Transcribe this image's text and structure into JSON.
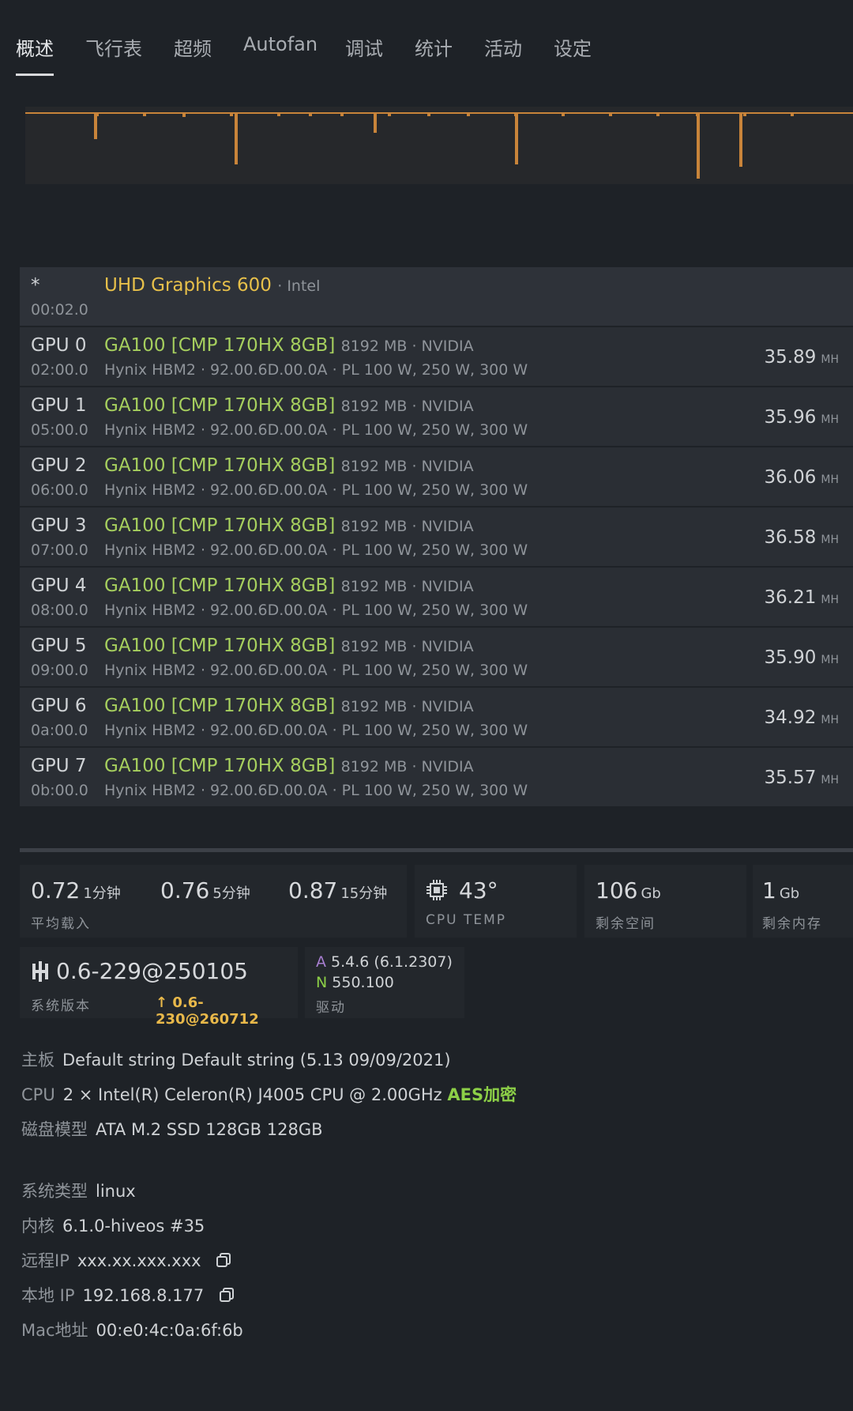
{
  "tabs": [
    "概述",
    "飞行表",
    "超频",
    "Autofan",
    "调试",
    "统计",
    "活动",
    "设定"
  ],
  "intel_gpu": {
    "idx": "*",
    "bus": "00:02.0",
    "name": "UHD Graphics 600",
    "vendor": "· Intel"
  },
  "gpus": [
    {
      "idx": "GPU 0",
      "bus": "02:00.0",
      "name": "GA100 [CMP 170HX 8GB]",
      "meta": "8192 MB · NVIDIA",
      "sub": "Hynix HBM2 · 92.00.6D.00.0A · PL 100 W, 250 W, 300 W",
      "hash": "35.89",
      "unit": "MH"
    },
    {
      "idx": "GPU 1",
      "bus": "05:00.0",
      "name": "GA100 [CMP 170HX 8GB]",
      "meta": "8192 MB · NVIDIA",
      "sub": "Hynix HBM2 · 92.00.6D.00.0A · PL 100 W, 250 W, 300 W",
      "hash": "35.96",
      "unit": "MH"
    },
    {
      "idx": "GPU 2",
      "bus": "06:00.0",
      "name": "GA100 [CMP 170HX 8GB]",
      "meta": "8192 MB · NVIDIA",
      "sub": "Hynix HBM2 · 92.00.6D.00.0A · PL 100 W, 250 W, 300 W",
      "hash": "36.06",
      "unit": "MH"
    },
    {
      "idx": "GPU 3",
      "bus": "07:00.0",
      "name": "GA100 [CMP 170HX 8GB]",
      "meta": "8192 MB · NVIDIA",
      "sub": "Hynix HBM2 · 92.00.6D.00.0A · PL 100 W, 250 W, 300 W",
      "hash": "36.58",
      "unit": "MH"
    },
    {
      "idx": "GPU 4",
      "bus": "08:00.0",
      "name": "GA100 [CMP 170HX 8GB]",
      "meta": "8192 MB · NVIDIA",
      "sub": "Hynix HBM2 · 92.00.6D.00.0A · PL 100 W, 250 W, 300 W",
      "hash": "36.21",
      "unit": "MH"
    },
    {
      "idx": "GPU 5",
      "bus": "09:00.0",
      "name": "GA100 [CMP 170HX 8GB]",
      "meta": "8192 MB · NVIDIA",
      "sub": "Hynix HBM2 · 92.00.6D.00.0A · PL 100 W, 250 W, 300 W",
      "hash": "35.90",
      "unit": "MH"
    },
    {
      "idx": "GPU 6",
      "bus": "0a:00.0",
      "name": "GA100 [CMP 170HX 8GB]",
      "meta": "8192 MB · NVIDIA",
      "sub": "Hynix HBM2 · 92.00.6D.00.0A · PL 100 W, 250 W, 300 W",
      "hash": "34.92",
      "unit": "MH"
    },
    {
      "idx": "GPU 7",
      "bus": "0b:00.0",
      "name": "GA100 [CMP 170HX 8GB]",
      "meta": "8192 MB · NVIDIA",
      "sub": "Hynix HBM2 · 92.00.6D.00.0A · PL 100 W, 250 W, 300 W",
      "hash": "35.57",
      "unit": "MH"
    }
  ],
  "load": {
    "v1": "0.72",
    "u1": "1分钟",
    "v5": "0.76",
    "u5": "5分钟",
    "v15": "0.87",
    "u15": "15分钟",
    "label": "平均载入"
  },
  "cpu_temp": {
    "value": "43°",
    "label": "CPU TEMP",
    "icon": "cpu-chip-icon"
  },
  "disk_free": {
    "value": "106",
    "unit": "Gb",
    "label": "剩余空间"
  },
  "mem_free": {
    "value": "1",
    "unit": "Gb",
    "label": "剩余内存"
  },
  "version": {
    "value": "0.6-229@250105",
    "label": "系统版本",
    "update": "0.6-230@260712",
    "icon": "hive-logo-icon"
  },
  "driver": {
    "a_tag": "A",
    "a_val": "5.4.6 (6.1.2307)",
    "n_tag": "N",
    "n_val": "550.100",
    "label": "驱动"
  },
  "info": {
    "board_k": "主板",
    "board_v": "Default string Default string (5.13 09/09/2021)",
    "cpu_k": "CPU",
    "cpu_v": "2 × Intel(R) Celeron(R) J4005 CPU @ 2.00GHz",
    "cpu_aes": "AES加密",
    "disk_k": "磁盘模型",
    "disk_v": "ATA M.2 SSD 128GB 128GB",
    "os_k": "系统类型",
    "os_v": "linux",
    "kernel_k": "内核",
    "kernel_v": "6.1.0-hiveos #35",
    "rip_k": "远程IP",
    "rip_v": "xxx.xx.xxx.xxx",
    "lip_k": "本地 IP",
    "lip_v": "192.168.8.177",
    "mac_k": "Mac地址",
    "mac_v": "00:e0:4c:0a:6f:6b"
  }
}
